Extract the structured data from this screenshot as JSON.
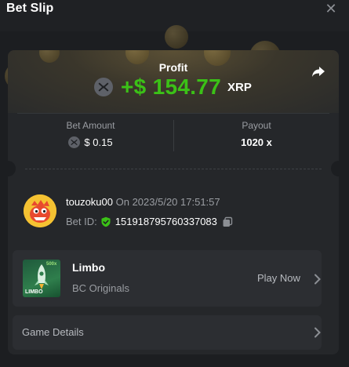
{
  "header": {
    "title": "Bet Slip",
    "close_icon": "close-icon"
  },
  "profit": {
    "label": "Profit",
    "amount": "+$ 154.77",
    "currency": "XRP",
    "color": "#3bc117",
    "icon": "xrp-icon"
  },
  "share_icon": "share-icon",
  "stats": {
    "bet_amount": {
      "label": "Bet Amount",
      "value": "$ 0.15"
    },
    "payout": {
      "label": "Payout",
      "value": "1020 x"
    }
  },
  "user": {
    "name": "touzoku00",
    "timestamp": "On 2023/5/20 17:51:57",
    "bet_id_label": "Bet ID:",
    "bet_id": "151918795760337083"
  },
  "game": {
    "name": "Limbo",
    "provider": "BC Originals",
    "play_label": "Play Now",
    "thumb_label": "LIMBO",
    "thumb_multiplier": "500x"
  },
  "details": {
    "label": "Game Details"
  }
}
